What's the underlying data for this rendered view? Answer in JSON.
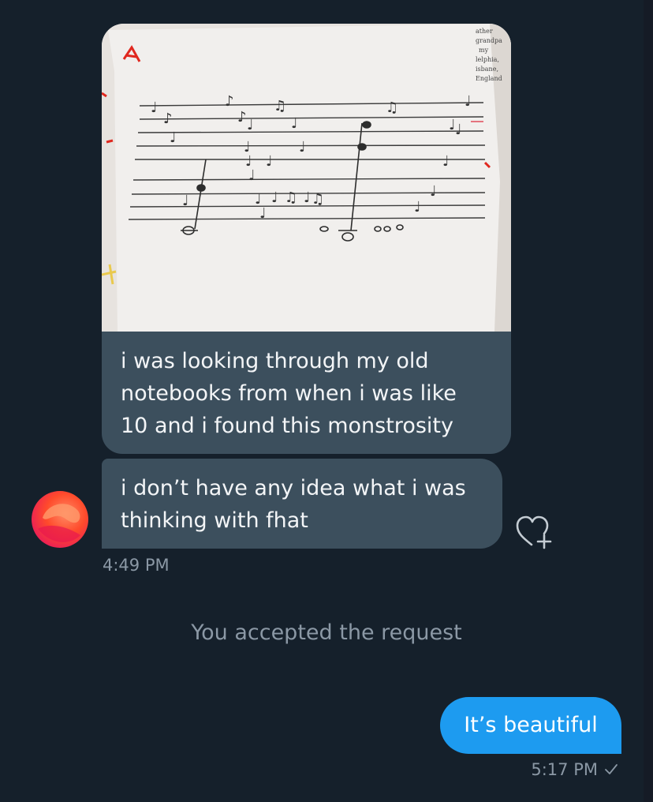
{
  "conversation": {
    "incoming": {
      "photo": {
        "description_icon": "sheet-music-photo",
        "corner_text": [
          "ather",
          "grandpa",
          "my",
          "lelphia,",
          "isbane,",
          "England"
        ]
      },
      "messages": [
        {
          "text": "i was looking through my old\nnotebooks from when i was like\n10 and i found this monstrosity"
        },
        {
          "text": "i don’t have any idea what i was\nthinking with fhat"
        }
      ],
      "timestamp": "4:49 PM",
      "react_icon": "heart-plus-icon",
      "avatar_icon": "avatar-gradient"
    },
    "system_message": "You accepted the request",
    "outgoing": {
      "messages": [
        {
          "text": "It’s beautiful"
        }
      ],
      "timestamp": "5:17 PM",
      "status_icon": "check-icon"
    }
  },
  "colors": {
    "background": "#15202b",
    "incoming_bubble": "#3c4f5d",
    "outgoing_bubble": "#1d9bf0",
    "secondary_text": "#8b98a5"
  }
}
